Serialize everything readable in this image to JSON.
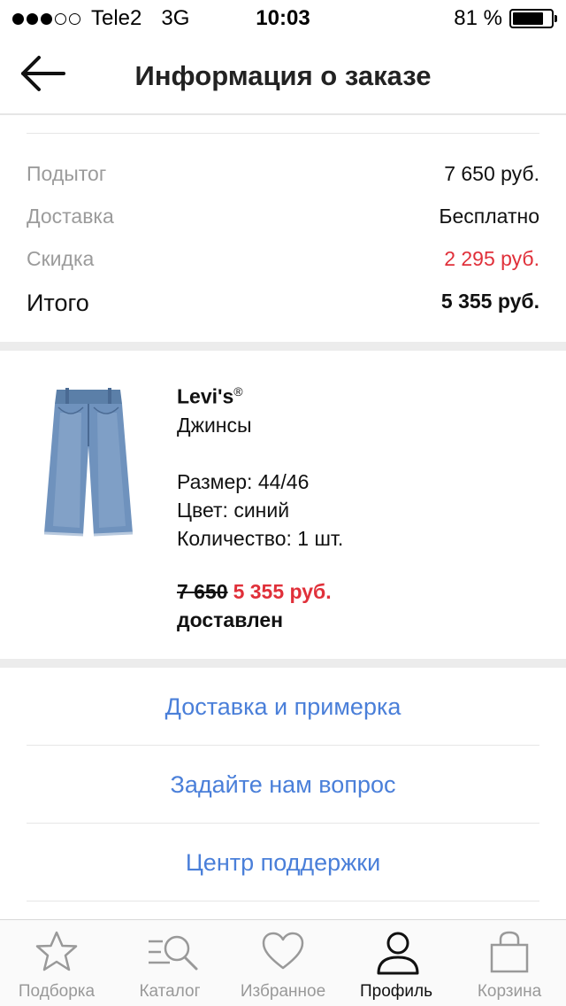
{
  "status_bar": {
    "carrier": "Tele2",
    "network": "3G",
    "time": "10:03",
    "battery_text": "81 %",
    "battery_level": 0.81,
    "signal_filled": 3,
    "signal_total": 5
  },
  "header": {
    "back_icon": "arrow-left-icon",
    "title": "Информация о заказе"
  },
  "totals": {
    "subtotal_label": "Подытог",
    "subtotal_value": "7 650 руб.",
    "delivery_label": "Доставка",
    "delivery_value": "Бесплатно",
    "discount_label": "Скидка",
    "discount_value": "2 295 руб.",
    "total_label": "Итого",
    "total_value": "5 355 руб."
  },
  "product": {
    "image_icon": "jeans-image",
    "brand": "Levi's",
    "brand_mark": "®",
    "name": "Джинсы",
    "size": "Размер: 44/46",
    "color": "Цвет: синий",
    "quantity": "Количество: 1 шт.",
    "old_price": "7 650",
    "new_price": "5 355 руб.",
    "status": "доставлен"
  },
  "links": [
    {
      "label": "Доставка и примерка"
    },
    {
      "label": "Задайте нам вопрос"
    },
    {
      "label": "Центр поддержки"
    }
  ],
  "tabbar": {
    "tabs": [
      {
        "label": "Подборка",
        "icon": "star-icon",
        "active": false
      },
      {
        "label": "Каталог",
        "icon": "catalog-search-icon",
        "active": false
      },
      {
        "label": "Избранное",
        "icon": "heart-icon",
        "active": false
      },
      {
        "label": "Профиль",
        "icon": "profile-icon",
        "active": true
      },
      {
        "label": "Корзина",
        "icon": "bag-icon",
        "active": false
      }
    ]
  },
  "colors": {
    "accent_link": "#4a7fd9",
    "sale_red": "#e0303a",
    "muted_label": "#9b9b9b"
  }
}
